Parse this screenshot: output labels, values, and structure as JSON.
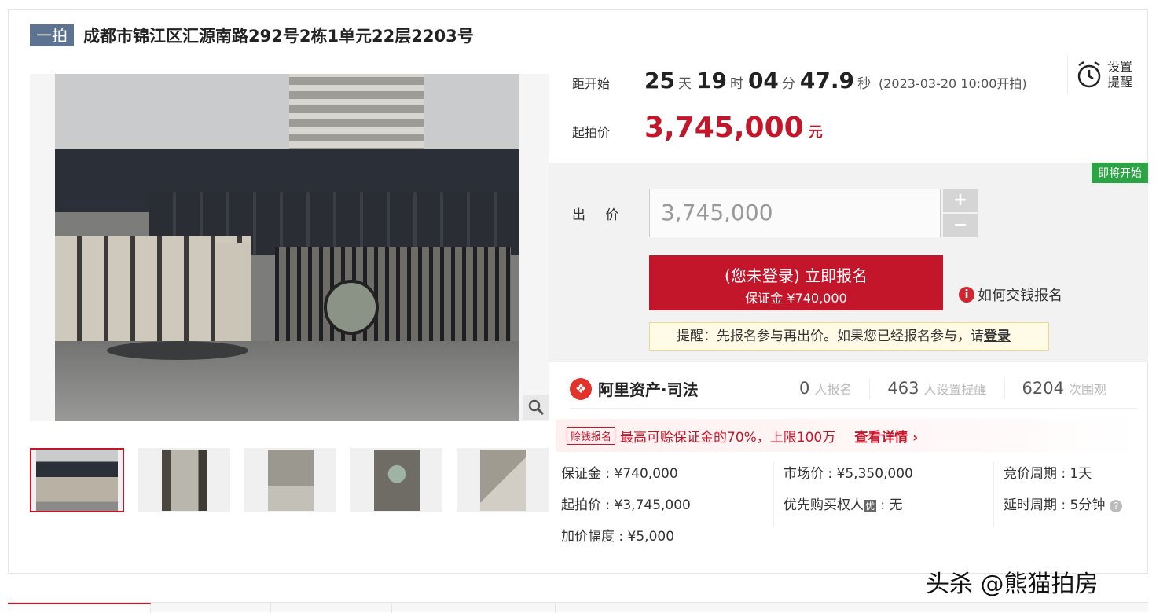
{
  "header": {
    "badge": "一拍",
    "title": "成都市锦江区汇源南路292号2栋1单元22层2203号"
  },
  "countdown": {
    "label": "距开始",
    "days": "25",
    "days_unit": "天",
    "hours": "19",
    "hours_unit": "时",
    "minutes": "04",
    "minutes_unit": "分",
    "seconds": "47.9",
    "seconds_unit": "秒",
    "start_note": "(2023-03-20 10:00开拍)"
  },
  "reminder": {
    "label": "设置提醒"
  },
  "starting_price": {
    "label": "起拍价",
    "value": "3,745,000",
    "unit": "元"
  },
  "bid": {
    "status_badge": "即将开始",
    "label": "出 价",
    "input_value": "3,745,000",
    "plus": "+",
    "minus": "−",
    "signup_main": "(您未登录) 立即报名",
    "signup_sub": "保证金 ¥740,000",
    "howto_icon": "i",
    "howto": "如何交钱报名",
    "tip_prefix": "提醒：先报名参与再出价。如果您已经报名参与，请",
    "tip_login": "登录"
  },
  "stats": {
    "brand": "阿里资产·司法",
    "signups": "0",
    "signups_label": "人报名",
    "reminders": "463",
    "reminders_label": "人设置提醒",
    "views": "6204",
    "views_label": "次围观"
  },
  "loan": {
    "tag": "赊钱报名",
    "text": "最高可赊保证金的70%，上限100万",
    "link": "查看详情 ›"
  },
  "details": {
    "deposit": "保证金 : ¥740,000",
    "start_price": "起拍价 : ¥3,745,000",
    "increment": "加价幅度 : ¥5,000",
    "market_price": "市场价 : ¥5,350,000",
    "priority_label": "优先购买权人",
    "priority_badge": "优",
    "priority_value": " : 无",
    "cycle": "竞价周期 : 1天",
    "extension": "延时周期 : 5分钟",
    "help_icon": "?"
  },
  "watermark": "头杀 @熊猫拍房",
  "icons": {
    "zoom": "magnifier-icon",
    "alarm": "alarm-clock-icon"
  },
  "colors": {
    "accent": "#c4162a",
    "badge": "#5d7392",
    "soon": "#2ca345"
  }
}
